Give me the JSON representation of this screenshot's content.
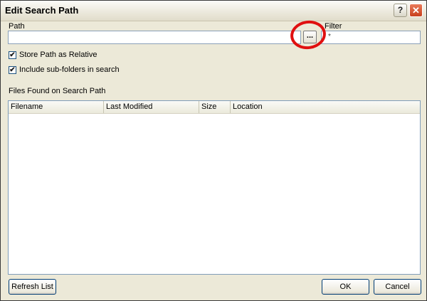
{
  "window": {
    "title": "Edit Search Path",
    "help_label": "?",
    "close_label": "✕"
  },
  "path": {
    "label": "Path",
    "value": "",
    "browse_label": "..."
  },
  "filter": {
    "label": "Filter",
    "value": "*"
  },
  "options": {
    "store_relative_label": "Store Path as Relative",
    "store_relative_checked": true,
    "include_subfolders_label": "Include sub-folders in search",
    "include_subfolders_checked": true,
    "check_mark": "✔"
  },
  "files": {
    "section_label": "Files Found on Search Path",
    "columns": [
      "Filename",
      "Last Modified",
      "Size",
      "Location"
    ],
    "rows": []
  },
  "buttons": {
    "refresh": "Refresh List",
    "ok": "OK",
    "cancel": "Cancel"
  },
  "colors": {
    "annotation_circle": "#e01010",
    "dialog_bg": "#ece9d8"
  }
}
